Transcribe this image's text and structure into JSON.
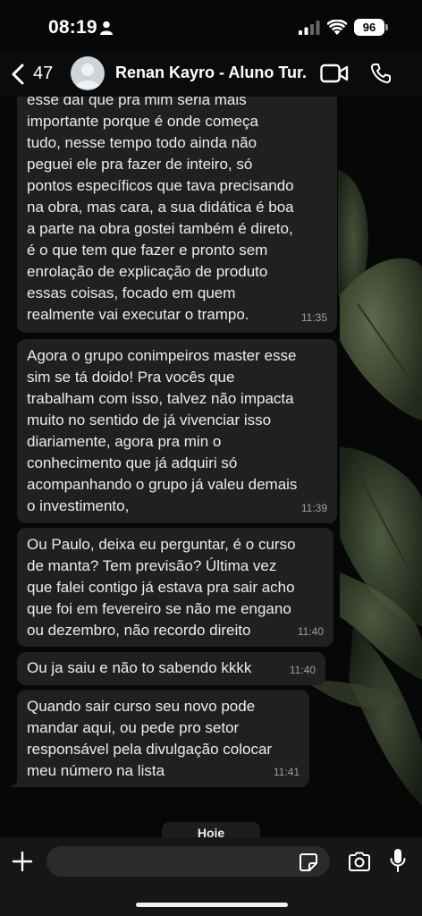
{
  "status_bar": {
    "time": "08:19",
    "battery": "96"
  },
  "header": {
    "back_count": "47",
    "contact_name": "Renan Kayro - Aluno Tur..."
  },
  "messages": [
    {
      "text": "esse daí que pra mim seria mais\nimportante  porque é onde começa\ntudo, nesse tempo todo ainda não\npeguei ele pra fazer de inteiro, só\npontos específicos que tava precisando\nna obra, mas cara, a sua didática é boa\na parte na obra gostei também é direto,\né  o que tem que fazer e pronto sem\nenrolação de explicação de produto\nessas coisas, focado em quem\nrealmente vai executar o trampo.",
      "time": "11:35"
    },
    {
      "text": "Agora o grupo conimpeiros master esse\nsim se tá doido! Pra vocês que\ntrabalham com isso, talvez não impacta\nmuito no sentido de já vivenciar isso\ndiariamente, agora pra min o\nconhecimento que já adquiri só\nacompanhando o grupo já valeu demais\no investimento,",
      "time": "11:39"
    },
    {
      "text": "Ou Paulo, deixa eu perguntar, é o curso\nde manta? Tem previsão? Última vez\nque falei contigo já estava pra sair acho\nque foi em fevereiro se não me engano\nou dezembro, não recordo direito",
      "time": "11:40"
    },
    {
      "text": "Ou ja saiu e não to sabendo kkkk",
      "time": "11:40"
    },
    {
      "text": "Quando sair curso seu novo pode\nmandar aqui, ou pede pro setor\nresponsável pela divulgação colocar\nmeu número na lista",
      "time": "11:41"
    }
  ],
  "date_separator": "Hoje",
  "composer": {
    "placeholder": ""
  }
}
